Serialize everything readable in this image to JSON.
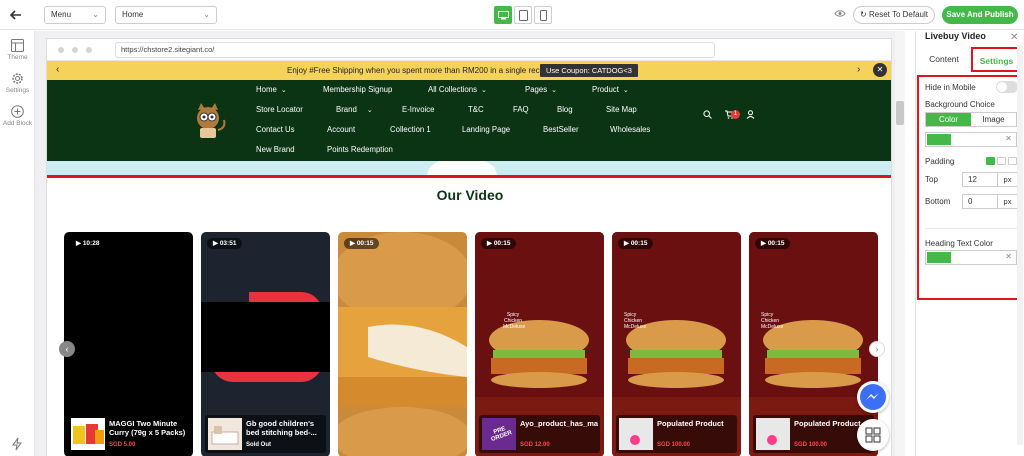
{
  "toolbar": {
    "menu_select": "Menu",
    "page_select": "Home",
    "reset_label": "Reset To Default",
    "save_label": "Save And Publish",
    "device_modes": [
      "desktop",
      "tablet",
      "mobile"
    ],
    "active_device": "desktop"
  },
  "leftbar": {
    "items": [
      {
        "label": "Theme",
        "icon": "layout-icon"
      },
      {
        "label": "Settings",
        "icon": "gear-icon"
      },
      {
        "label": "Add Block",
        "icon": "plus-circle-icon"
      }
    ],
    "bottom_icon": "lightning-icon"
  },
  "browser": {
    "url": "https://chstore2.sitegiant.co/"
  },
  "store": {
    "announcement": "Enjoy #Free Shipping when you spent more than RM200 in a single receipt",
    "coupon_label": "Use Coupon: CATDOG<3",
    "nav_row1": [
      "Home",
      "Membership Signup",
      "All Collections",
      "Pages",
      "Product"
    ],
    "nav_row2": [
      "Store Locator",
      "Brand",
      "E-Invoice",
      "T&C",
      "FAQ",
      "Blog",
      "Site Map"
    ],
    "nav_row3": [
      "Contact Us",
      "Account",
      "Collection 1",
      "Landing Page",
      "BestSeller",
      "Wholesales"
    ],
    "nav_row4": [
      "New Brand",
      "Points Redemption"
    ],
    "cart_count": "1",
    "section_title": "Our Video"
  },
  "videos": [
    {
      "duration": "10:28",
      "product": "MAGGI Two Minute Curry (79g x 5 Packs)",
      "price": "SGD 5.00",
      "status": ""
    },
    {
      "duration": "03:51",
      "product": "Gb good children's bed stitching bed-...",
      "price": "",
      "status": "Sold Out"
    },
    {
      "duration": "00:15",
      "product": "",
      "price": "",
      "status": ""
    },
    {
      "duration": "00:15",
      "product": "Ayo_product_has_mar",
      "price": "SGD 12.00",
      "status": "PRE ORDER"
    },
    {
      "duration": "00:15",
      "product": "Populated Product",
      "price": "SGD 100.00",
      "status": ""
    },
    {
      "duration": "00:15",
      "product": "Populated Product",
      "price": "SGD 100.00",
      "status": ""
    }
  ],
  "burger_text": "Spicy Chicken McDeluxe",
  "panel": {
    "title": "Livebuy Video",
    "tab_content": "Content",
    "tab_settings": "Settings",
    "hide_mobile_label": "Hide in Mobile",
    "hide_mobile": false,
    "bg_choice_label": "Background Choice",
    "bg_color_label": "Color",
    "bg_image_label": "Image",
    "bg_color": "#44b848",
    "padding_label": "Padding",
    "top_label": "Top",
    "top_value": "12",
    "bottom_label": "Bottom",
    "bottom_value": "0",
    "unit": "px",
    "heading_color_label": "Heading Text Color",
    "heading_color": "#44b848"
  },
  "colors": {
    "accent": "#44b848",
    "header_bg": "#0b3415",
    "announce_bg": "#f5d35a",
    "highlight": "#e0141d"
  }
}
